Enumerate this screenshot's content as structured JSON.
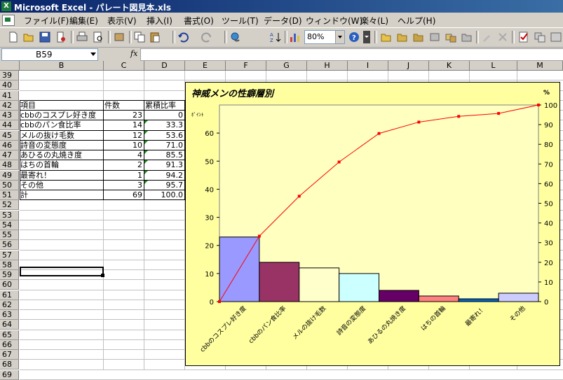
{
  "window": {
    "title": "Microsoft Excel - パレート図見本.xls",
    "app_icon": "excel-icon"
  },
  "menu": [
    "ファイル(F)",
    "編集(E)",
    "表示(V)",
    "挿入(I)",
    "書式(O)",
    "ツール(T)",
    "データ(D)",
    "ウィンドウ(W)",
    "楽々(L)",
    "ヘルプ(H)"
  ],
  "toolbar": {
    "zoom": "80%",
    "sum_symbol": "Σ"
  },
  "formula_bar": {
    "name_box": "B59",
    "fx_label": "fx",
    "content": ""
  },
  "columns": [
    "B",
    "C",
    "D",
    "E",
    "F",
    "G",
    "H",
    "I",
    "J",
    "K",
    "L",
    "M"
  ],
  "rows": [
    "39",
    "40",
    "41",
    "42",
    "43",
    "44",
    "45",
    "46",
    "47",
    "48",
    "49",
    "50",
    "51",
    "52",
    "53",
    "54",
    "55",
    "56",
    "57",
    "58",
    "59",
    "60",
    "61",
    "62",
    "63",
    "64",
    "65",
    "66",
    "67",
    "68",
    "69"
  ],
  "table": {
    "headers": [
      "項目",
      "件数",
      "累積比率"
    ],
    "rows": [
      [
        "cbbのコスプレ好き度",
        "23",
        "0"
      ],
      [
        "cbbのパン食比率",
        "14",
        "33.3"
      ],
      [
        "メルの抜け毛数",
        "12",
        "53.6"
      ],
      [
        "詩音の変態度",
        "10",
        "71.0"
      ],
      [
        "あひるの丸焼き度",
        "4",
        "85.5"
      ],
      [
        "はちの首輪",
        "2",
        "91.3"
      ],
      [
        "最寄れ！",
        "1",
        "94.2"
      ],
      [
        "その他",
        "3",
        "95.7"
      ],
      [
        "計",
        "69",
        "100.0"
      ]
    ]
  },
  "chart_data": {
    "type": "bar",
    "title": "神威メンの性癖層別",
    "ylabel": "ﾎﾟｲﾝﾄ",
    "y2label": "%",
    "categories": [
      "cbbのコスプレ好き度",
      "cbbのパン食比率",
      "メルの抜け毛数",
      "詩音の変態度",
      "あひるの丸焼き度",
      "はちの首輪",
      "最寄れ！",
      "その他"
    ],
    "bar_values": [
      23,
      14,
      12,
      10,
      4,
      2,
      1,
      3
    ],
    "bar_colors": [
      "#9999ff",
      "#993366",
      "#ffffcc",
      "#ccffff",
      "#660066",
      "#ff8080",
      "#0066cc",
      "#ccccff"
    ],
    "cumulative_values": [
      0,
      33.3,
      53.6,
      71.0,
      85.5,
      91.3,
      94.2,
      95.7,
      100
    ],
    "line_color": "#ff0000",
    "plot_bg": "#ffffc0",
    "chart_bg": "#ffffa0",
    "ylim": [
      0,
      70
    ],
    "yticks": [
      0,
      10,
      20,
      30,
      40,
      50,
      60
    ],
    "y2lim": [
      0,
      100
    ],
    "y2ticks": [
      0,
      10,
      20,
      30,
      40,
      50,
      60,
      70,
      80,
      90,
      100
    ],
    "grid": false
  },
  "selected_cell": "B59"
}
